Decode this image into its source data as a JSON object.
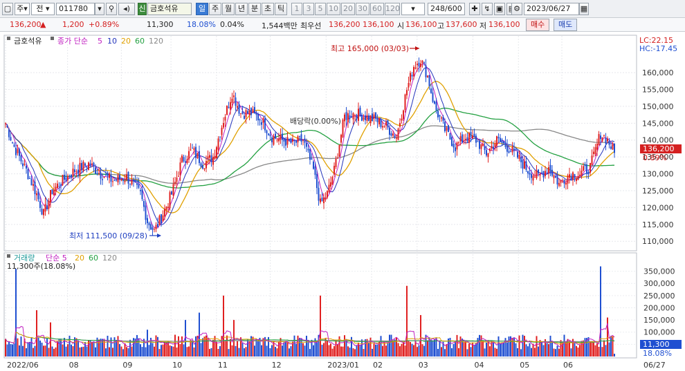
{
  "toolbar": {
    "market": "주",
    "range": "전",
    "code": "011780",
    "name": "금호석유",
    "name_badge": "신",
    "periods": [
      "일",
      "주",
      "월",
      "년",
      "분",
      "초",
      "틱"
    ],
    "active_period": "일",
    "intervals": [
      "1",
      "3",
      "5",
      "10",
      "20",
      "30",
      "60",
      "120"
    ],
    "count": "248/600",
    "date": "2023/06/27"
  },
  "quote": {
    "price": "136,200",
    "change": "1,200",
    "change_pct": "+0.89%",
    "volume": "11,300",
    "vol_ratio": "18.08%",
    "turnover": "0.04%",
    "amount": "1,544백만",
    "best_label": "최우선",
    "ask": "136,200",
    "bid": "136,100",
    "open_label": "시",
    "open": "136,100",
    "high_label": "고",
    "high": "137,600",
    "low_label": "저",
    "low": "136,100",
    "buy_label": "매수",
    "sell_label": "매도"
  },
  "colors": {
    "up": "#e02020",
    "down": "#1f4fd1",
    "ma5": "#c020c0",
    "ma10": "#2233bb",
    "ma20": "#e0a000",
    "ma60": "#22a040",
    "ma120": "#888888"
  },
  "price_panel": {
    "legend_name": "금호석유",
    "legend_items": [
      "종가 단순",
      "5",
      "10",
      "20",
      "60",
      "120"
    ],
    "lc": "LC:22.15",
    "hc": "HC:-17.45",
    "last_price": "136,200",
    "last_pct": "0.89%",
    "hi_annot": "최고 165,000 (03/03)",
    "lo_annot": "최저 111,500 (09/28)",
    "div_annot": "배당락(0.00%)",
    "y_ticks": [
      "160,000",
      "155,000",
      "150,000",
      "145,000",
      "140,000",
      "135,000",
      "130,000",
      "125,000",
      "120,000",
      "115,000",
      "110,000"
    ]
  },
  "volume_panel": {
    "legend_items": [
      "거래량",
      "단순 5",
      "20",
      "60",
      "120"
    ],
    "sub": "11,300주(18.08%)",
    "last_vol": "11,300",
    "last_pct": "18.08%",
    "y_ticks": [
      "350,000",
      "300,000",
      "250,000",
      "200,000",
      "150,000",
      "100,000",
      "50,000"
    ]
  },
  "x_axis": {
    "labels": [
      "2022/06",
      "08",
      "09",
      "10",
      "11",
      "12",
      "2023/01",
      "02",
      "03",
      "04",
      "05",
      "06"
    ],
    "last": "06/27"
  },
  "chart_data": {
    "type": "candlestick",
    "period": "daily",
    "x_range": [
      "2022/06",
      "2023/06/27"
    ],
    "y_range": [
      108000,
      168000
    ],
    "volume_y_range": [
      0,
      380000
    ],
    "anchors": [
      [
        0,
        145000
      ],
      [
        5,
        138000
      ],
      [
        12,
        131000
      ],
      [
        18,
        124000
      ],
      [
        22,
        118000
      ],
      [
        27,
        125000
      ],
      [
        33,
        128000
      ],
      [
        40,
        131000
      ],
      [
        48,
        133000
      ],
      [
        55,
        130000
      ],
      [
        62,
        128000
      ],
      [
        70,
        129000
      ],
      [
        78,
        124000
      ],
      [
        82,
        116000
      ],
      [
        86,
        113000
      ],
      [
        90,
        117000
      ],
      [
        96,
        124000
      ],
      [
        102,
        134000
      ],
      [
        108,
        137000
      ],
      [
        114,
        133000
      ],
      [
        120,
        135000
      ],
      [
        126,
        146000
      ],
      [
        131,
        154000
      ],
      [
        136,
        148000
      ],
      [
        142,
        148000
      ],
      [
        148,
        146000
      ],
      [
        154,
        141000
      ],
      [
        160,
        140000
      ],
      [
        166,
        139000
      ],
      [
        172,
        140000
      ],
      [
        178,
        131000
      ],
      [
        182,
        121000
      ],
      [
        186,
        124000
      ],
      [
        190,
        131000
      ],
      [
        196,
        147000
      ],
      [
        202,
        148000
      ],
      [
        208,
        147000
      ],
      [
        214,
        146000
      ],
      [
        220,
        144000
      ],
      [
        226,
        141000
      ],
      [
        232,
        155000
      ],
      [
        236,
        162000
      ],
      [
        240,
        164000
      ],
      [
        244,
        159000
      ],
      [
        248,
        150000
      ],
      [
        254,
        143000
      ],
      [
        260,
        138000
      ],
      [
        266,
        141000
      ],
      [
        272,
        140000
      ],
      [
        278,
        136000
      ],
      [
        284,
        140000
      ],
      [
        290,
        138000
      ],
      [
        296,
        135000
      ],
      [
        302,
        131000
      ],
      [
        308,
        129000
      ],
      [
        314,
        132000
      ],
      [
        320,
        127000
      ],
      [
        326,
        130000
      ],
      [
        332,
        130000
      ],
      [
        338,
        132000
      ],
      [
        344,
        142000
      ],
      [
        348,
        140000
      ],
      [
        352,
        136200
      ]
    ],
    "volume_spikes": [
      [
        6,
        360000
      ],
      [
        18,
        190000
      ],
      [
        26,
        140000
      ],
      [
        82,
        110000
      ],
      [
        104,
        150000
      ],
      [
        112,
        180000
      ],
      [
        126,
        250000
      ],
      [
        132,
        150000
      ],
      [
        182,
        250000
      ],
      [
        232,
        290000
      ],
      [
        240,
        170000
      ],
      [
        344,
        370000
      ],
      [
        348,
        160000
      ]
    ]
  }
}
